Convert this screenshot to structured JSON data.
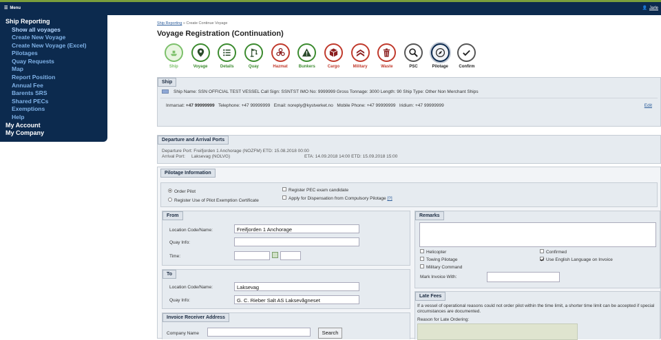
{
  "topbar": {
    "menu_label": "Menu",
    "user_label": "Jarle"
  },
  "sidebar": {
    "ship_reporting": "Ship Reporting",
    "items": [
      "Show all voyages",
      "Create New Voyage",
      "Create New Voyage (Excel)",
      "Pilotages",
      "Quay Requests",
      "Map",
      "Report Position",
      "Annual Fee",
      "Barents SRS",
      "Shared PECs",
      "Exemptions",
      "Help"
    ],
    "my_account": "My Account",
    "my_company": "My Company"
  },
  "breadcrumb": {
    "link": "Ship Reporting",
    "sep": " » ",
    "current": "Create Continue Voyage"
  },
  "page_title": "Voyage Registration (Continuation)",
  "steps": [
    {
      "label": "Ship",
      "icon": "ship-icon"
    },
    {
      "label": "Voyage",
      "icon": "location-pin-icon"
    },
    {
      "label": "Details",
      "icon": "list-icon"
    },
    {
      "label": "Quay",
      "icon": "crane-icon"
    },
    {
      "label": "Hazmat",
      "icon": "biohazard-icon"
    },
    {
      "label": "Bunkers",
      "icon": "warning-icon"
    },
    {
      "label": "Cargo",
      "icon": "cargo-box-icon"
    },
    {
      "label": "Military",
      "icon": "military-chevrons-icon"
    },
    {
      "label": "Waste",
      "icon": "trash-icon"
    },
    {
      "label": "PSC",
      "icon": "magnifier-icon"
    },
    {
      "label": "Pilotage",
      "icon": "compass-icon"
    },
    {
      "label": "Confirm",
      "icon": "checkmark-icon"
    }
  ],
  "ship": {
    "header": "Ship",
    "line1": "Ship Name: SSN OFFICIAL TEST VESSEL   Call Sign: SSNTST   IMO No: 9999999   Gross Tonnage: 3000   Length: 90   Ship Type: Other Non Merchant Ships",
    "inmarsat_label": "Inmarsat:",
    "inmarsat": "+47 99999999",
    "telephone_label": "Telephone:",
    "telephone": "+47 99999999",
    "email_label": "Email:",
    "email": "noreply@kystverket.no",
    "mobile_label": "Mobile Phone:",
    "mobile": "+47 99999999",
    "iridium_label": "Iridium:",
    "iridium": "+47 99999999",
    "edit": "Edit"
  },
  "ports": {
    "header": "Departure and Arrival Ports",
    "dep_label": "Departure Port:",
    "dep": "Freifjorden 1 Anchorage (NOZFM) ETD: 15.08.2018 00:00",
    "arr_label": "Arrival Port:",
    "arr": "Laksevag (NOLVG)",
    "arr_times": "ETA: 14.09.2018 14:00 ETD: 15.09.2018 15:00"
  },
  "pilotage": {
    "header": "Pilotage Information",
    "order_pilot": "Order Pilot",
    "register_pec": "Register Use of Pilot Exemption Certificate",
    "pec_candidate": "Register PEC exam candidate",
    "dispensation": "Apply for Dispensation from Compulsory Pilotage",
    "help": "[?]"
  },
  "from": {
    "header": "From",
    "location_label": "Location Code/Name:",
    "location_value": "Freifjorden 1 Anchorage",
    "quay_label": "Quay Info:",
    "quay_value": "",
    "time_label": "Time:",
    "date_value": "",
    "time_value": ""
  },
  "to": {
    "header": "To",
    "location_label": "Location Code/Name:",
    "location_value": "Laksevag",
    "quay_label": "Quay Info:",
    "quay_value": "G. C. Rieber Salt AS Laksevågneset"
  },
  "invoice": {
    "header": "Invoice Receiver Address",
    "company_label": "Company Name",
    "company_value": "",
    "search": "Search"
  },
  "remarks": {
    "header": "Remarks",
    "helicopter": "Helicopter",
    "towing": "Towing Pilotage",
    "military": "Military Command",
    "confirmed": "Confirmed",
    "english": "Use English Language on Invoice",
    "mark_invoice_label": "Mark Invoice With:",
    "mark_invoice_value": ""
  },
  "late_fees": {
    "header": "Late Fees",
    "text": "If a vessel of operational reasons could not order pilot within the time limit, a shorter time limit can be accepted if special circumstances are documented.",
    "reason_label": "Reason for Late Ordering:"
  }
}
